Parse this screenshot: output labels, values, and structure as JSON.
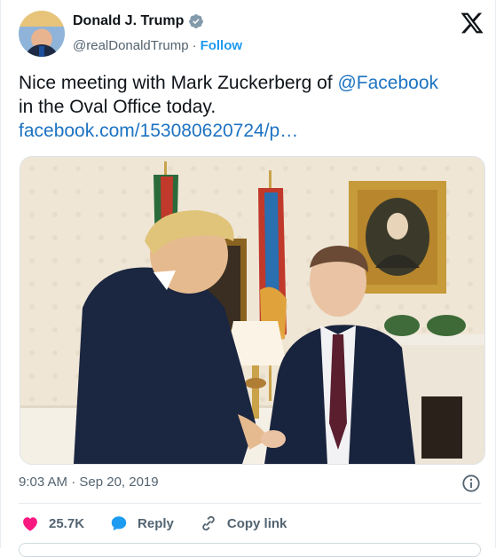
{
  "tweet": {
    "author": {
      "display_name": "Donald J. Trump",
      "handle": "@realDonaldTrump",
      "separator": "·",
      "follow_label": "Follow"
    },
    "text": {
      "line1_prefix": "Nice meeting with Mark Zuckerberg of ",
      "mention": "@Facebook",
      "line2": "in the Oval Office today.",
      "link": "facebook.com/153080620724/p…"
    },
    "timestamp": "9:03 AM · Sep 20, 2019",
    "actions": {
      "likes_count": "25.7K",
      "reply_label": "Reply",
      "copy_link_label": "Copy link"
    }
  },
  "colors": {
    "accent": "#1d9bf0",
    "like": "#f91880",
    "verified": "#829aab"
  },
  "icons": [
    "verified-badge-icon",
    "x-logo-icon",
    "info-icon",
    "heart-icon",
    "reply-bubble-icon",
    "link-icon"
  ]
}
